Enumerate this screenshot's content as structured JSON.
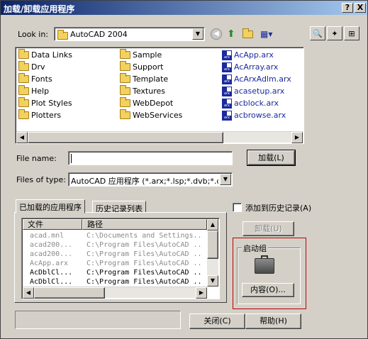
{
  "window": {
    "title": "加载/卸载应用程序",
    "help_btn": "?",
    "close_btn": "X"
  },
  "lookin": {
    "label": "Look in:",
    "value": "AutoCAD 2004"
  },
  "files": {
    "col1": [
      "Data Links",
      "Drv",
      "Fonts",
      "Help",
      "Plot Styles",
      "Plotters"
    ],
    "col2": [
      "Sample",
      "Support",
      "Template",
      "Textures",
      "WebDepot",
      "WebServices"
    ],
    "col3": [
      "AcApp.arx",
      "AcArray.arx",
      "AcArxAdlm.arx",
      "acasetup.arx",
      "acblock.arx",
      "acbrowse.arx"
    ]
  },
  "filename": {
    "label": "File name:",
    "value": ""
  },
  "filetype": {
    "label": "Files of type:",
    "value": "AutoCAD 应用程序 (*.arx;*.lsp;*.dvb;*.dbx;*."
  },
  "buttons": {
    "load": "加载(L)",
    "unload": "卸载(U)",
    "contents": "内容(O)...",
    "close": "关闭(C)",
    "help": "帮助(H)"
  },
  "tabs": {
    "loaded": "已加载的应用程序",
    "history": "历史记录列表"
  },
  "loaded_table": {
    "headers": [
      "文件",
      "路径"
    ],
    "rows": [
      {
        "file": "acad.mnl",
        "path": "C:\\Documents and Settings...",
        "grey": true
      },
      {
        "file": "acad200...",
        "path": "C:\\Program Files\\AutoCAD ...",
        "grey": true
      },
      {
        "file": "acad200...",
        "path": "C:\\Program Files\\AutoCAD ...",
        "grey": true
      },
      {
        "file": "AcApp.arx",
        "path": "C:\\Program Files\\AutoCAD ...",
        "grey": true
      },
      {
        "file": "AcDblCl...",
        "path": "C:\\Program Files\\AutoCAD ...",
        "grey": false
      },
      {
        "file": "AcDblCl...",
        "path": "C:\\Program Files\\AutoCAD ...",
        "grey": false
      }
    ]
  },
  "add_history": {
    "label": "添加到历史记录(A)"
  },
  "startup": {
    "label": "启动组"
  },
  "colors": {
    "titlebar_start": "#0a246a",
    "titlebar_end": "#a6caf0",
    "highlight_box": "#c00000",
    "arx_text": "#1a2a9c"
  }
}
